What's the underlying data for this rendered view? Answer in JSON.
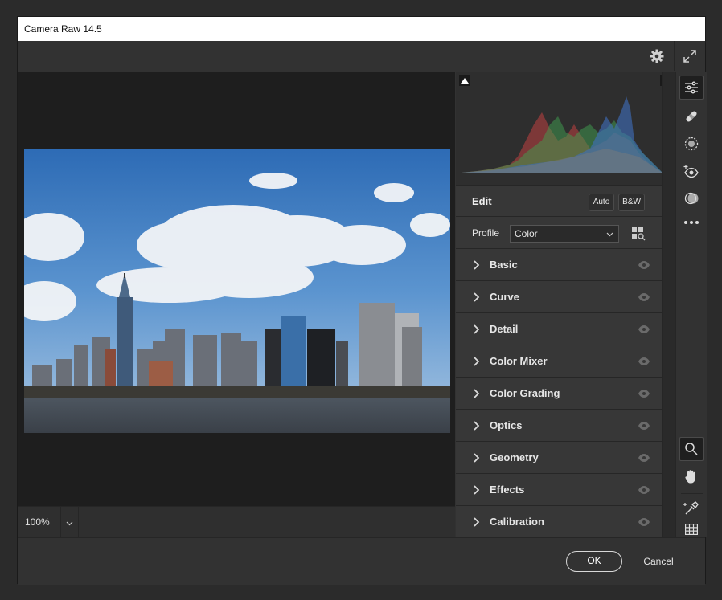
{
  "window": {
    "title": "Camera Raw 14.5"
  },
  "icons": {
    "settings": "gear-icon",
    "fullscreen": "expand-icon"
  },
  "status": {
    "zoom": "100%"
  },
  "edit_panel": {
    "title": "Edit",
    "auto_label": "Auto",
    "bw_label": "B&W",
    "profile_label": "Profile",
    "profile_value": "Color",
    "sections": [
      {
        "label": "Basic"
      },
      {
        "label": "Curve"
      },
      {
        "label": "Detail"
      },
      {
        "label": "Color Mixer"
      },
      {
        "label": "Color Grading"
      },
      {
        "label": "Optics"
      },
      {
        "label": "Geometry"
      },
      {
        "label": "Effects"
      },
      {
        "label": "Calibration"
      }
    ]
  },
  "tools": [
    "edit-sliders-icon",
    "healing-bandage-icon",
    "masking-icon",
    "red-eye-icon",
    "presets-icon",
    "more-icon",
    "zoom-icon",
    "hand-icon",
    "color-sampler-icon",
    "grid-icon"
  ],
  "footer": {
    "ok_label": "OK",
    "cancel_label": "Cancel"
  },
  "colors": {
    "accent": "#ffffff",
    "panel": "#373737",
    "background": "#323232"
  }
}
